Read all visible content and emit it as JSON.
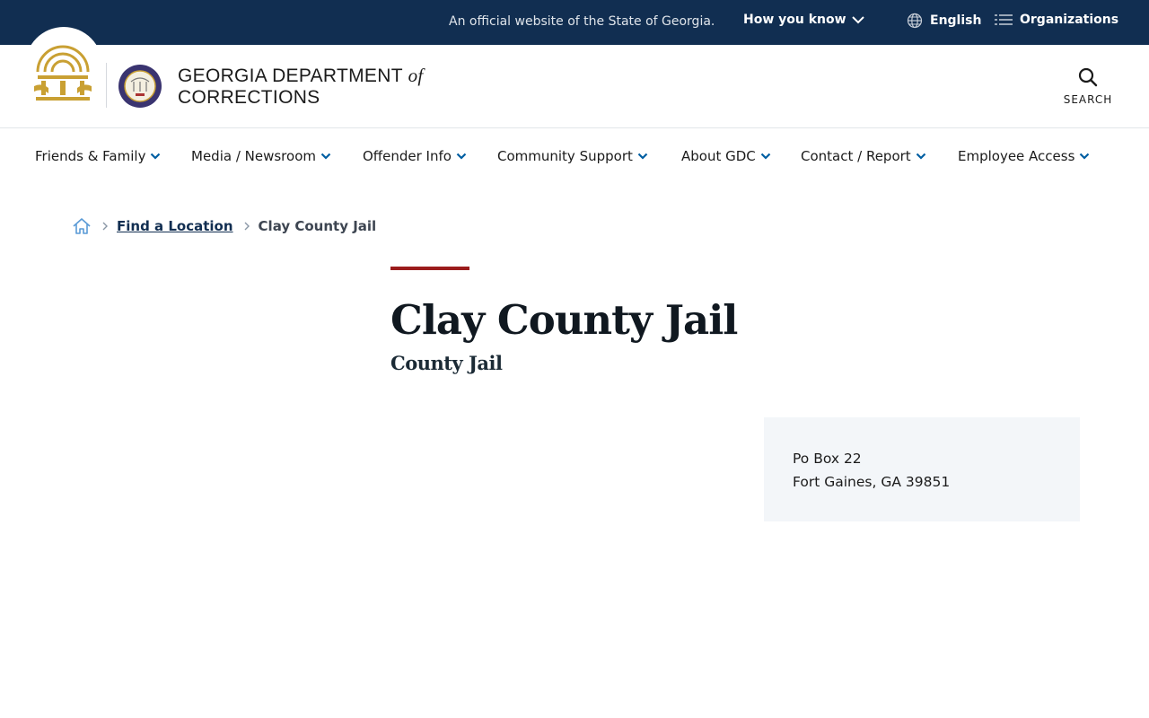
{
  "banner": {
    "official_text": "An official website of the State of Georgia.",
    "how_you_know": "How you know",
    "language": "English",
    "organizations": "Organizations"
  },
  "header": {
    "dept_line1_main": "GEORGIA DEPARTMENT",
    "dept_line1_of": "of",
    "dept_line2": "CORRECTIONS",
    "search_label": "SEARCH"
  },
  "nav": {
    "items": [
      {
        "label": "Friends & Family"
      },
      {
        "label": "Media / Newsroom"
      },
      {
        "label": "Offender Info"
      },
      {
        "label": "Community Support"
      },
      {
        "label": "About GDC"
      },
      {
        "label": "Contact / Report"
      },
      {
        "label": "Employee Access"
      }
    ]
  },
  "breadcrumb": {
    "link": "Find a Location",
    "current": "Clay County Jail"
  },
  "page": {
    "title": "Clay County Jail",
    "subtitle": "County Jail"
  },
  "address": {
    "line1": "Po Box 22",
    "line2": "Fort Gaines, GA 39851"
  },
  "colors": {
    "banner_bg": "#112e51",
    "accent_red": "#9b1c1c",
    "link_blue": "#112e51",
    "seal_gold": "#c9a033",
    "card_bg": "#f3f6f9"
  }
}
